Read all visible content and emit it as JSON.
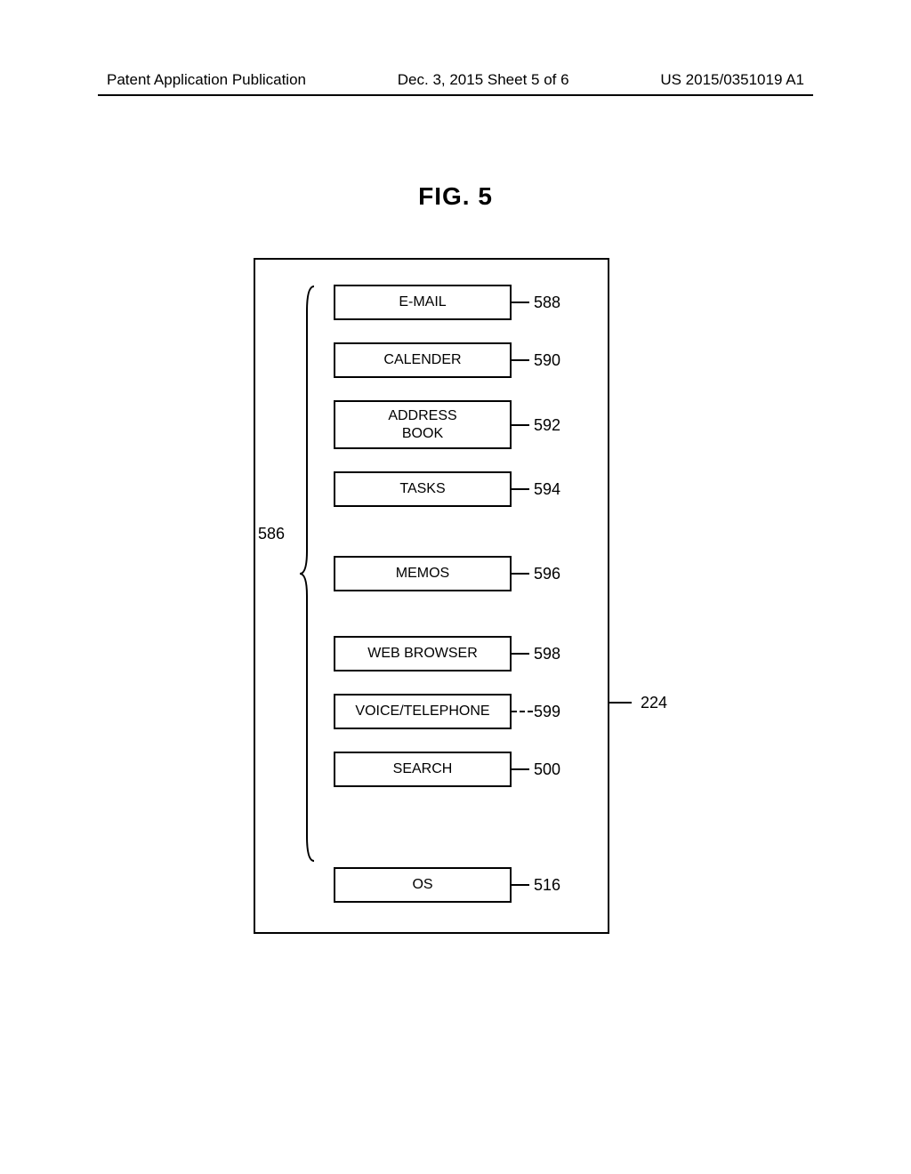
{
  "header": {
    "left": "Patent Application Publication",
    "center": "Dec. 3, 2015  Sheet 5 of 6",
    "right": "US 2015/0351019 A1"
  },
  "figure": {
    "title": "FIG. 5",
    "bracketLabel": "586",
    "outerRef": "224",
    "boxes": [
      {
        "label": "E-MAIL",
        "ref": "588"
      },
      {
        "label": "CALENDER",
        "ref": "590"
      },
      {
        "label": "ADDRESS\nBOOK",
        "ref": "592"
      },
      {
        "label": "TASKS",
        "ref": "594"
      },
      {
        "label": "MEMOS",
        "ref": "596"
      },
      {
        "label": "WEB BROWSER",
        "ref": "598"
      },
      {
        "label": "VOICE/TELEPHONE",
        "ref": "599"
      },
      {
        "label": "SEARCH",
        "ref": "500"
      },
      {
        "label": "OS",
        "ref": "516"
      }
    ]
  }
}
